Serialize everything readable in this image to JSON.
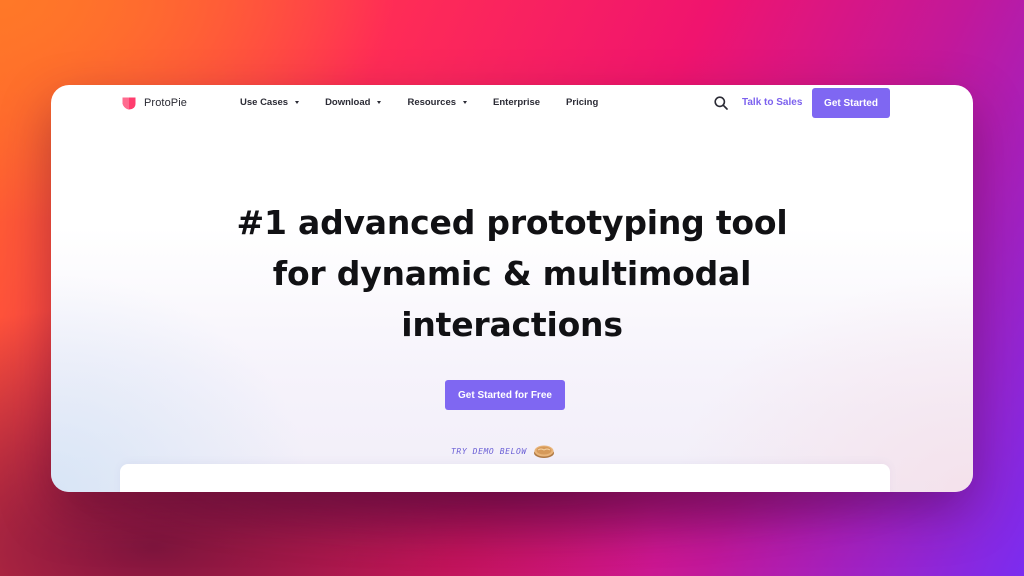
{
  "brand": {
    "name": "ProtoPie",
    "logo_color": "#ff3d6e"
  },
  "nav": {
    "items": [
      {
        "label": "Use Cases",
        "has_dropdown": true
      },
      {
        "label": "Download",
        "has_dropdown": true
      },
      {
        "label": "Resources",
        "has_dropdown": true
      },
      {
        "label": "Enterprise",
        "has_dropdown": false
      },
      {
        "label": "Pricing",
        "has_dropdown": false
      }
    ],
    "search_icon": "search-icon",
    "talk_to_sales": "Talk to Sales",
    "get_started": "Get Started"
  },
  "hero": {
    "title_lines": [
      "#1 advanced prototyping tool",
      "for dynamic & multimodal",
      "interactions"
    ],
    "cta": "Get Started for Free",
    "demo_hint": "TRY DEMO BELOW",
    "demo_icon": "pie-icon"
  },
  "colors": {
    "accent": "#7f67f2",
    "link": "#7c61ee",
    "heading": "#111114"
  }
}
